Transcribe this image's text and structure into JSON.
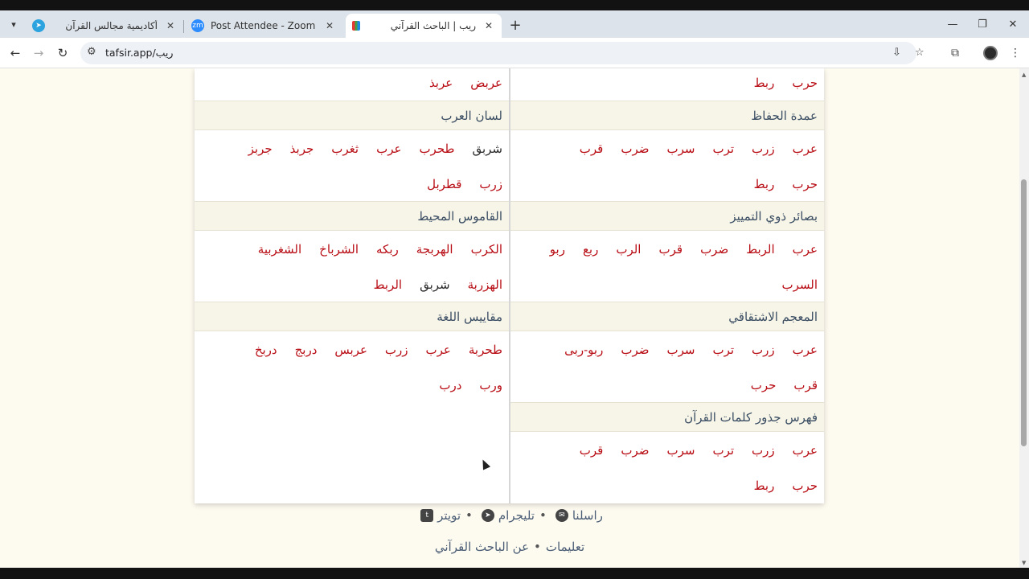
{
  "tabs": [
    {
      "title": "أكاديمية مجالس القرآن",
      "icon": "telegram-icon",
      "active": false
    },
    {
      "title": "Post Attendee - Zoom",
      "icon": "zoom-icon",
      "active": false
    },
    {
      "title": "ريب | الباحث القرآني",
      "icon": "tafsir-icon",
      "active": true
    }
  ],
  "address": {
    "url": "tafsir.app/ريب"
  },
  "right_column": {
    "top_row": [
      "حرب",
      "ربط"
    ],
    "sections": [
      {
        "title": "عمدة الحفاظ",
        "rows": [
          [
            "عرب",
            "زرب",
            "ترب",
            "سرب",
            "ضرب",
            "قرب"
          ],
          [
            "حرب",
            "ربط"
          ]
        ]
      },
      {
        "title": "بصائر ذوي التمييز",
        "rows": [
          [
            "عرب",
            "الربط",
            "ضرب",
            "قرب",
            "الرب",
            "ربع",
            "ربو"
          ],
          [
            "السرب"
          ]
        ]
      },
      {
        "title": "المعجم الاشتقاقي",
        "rows": [
          [
            "عرب",
            "زرب",
            "ترب",
            "سرب",
            "ضرب",
            "ربو-ربى"
          ],
          [
            "قرب",
            "حرب"
          ]
        ]
      },
      {
        "title": "فهرس جذور كلمات القرآن",
        "rows": [
          [
            "عرب",
            "زرب",
            "ترب",
            "سرب",
            "ضرب",
            "قرب"
          ],
          [
            "حرب",
            "ربط"
          ]
        ]
      }
    ]
  },
  "left_column": {
    "top_row": [
      "عربض",
      "عربذ"
    ],
    "sections": [
      {
        "title": "لسان العرب",
        "rows": [
          [
            "شربق",
            "طحرب",
            "عرب",
            "ثغرب",
            "جربذ",
            "جربز"
          ],
          [
            "زرب",
            "قطربل"
          ]
        ]
      },
      {
        "title": "القاموس المحيط",
        "rows": [
          [
            "الكرب",
            "الهربجة",
            "ربكه",
            "الشرباخ",
            "الشغربية"
          ],
          [
            "الهزربة",
            "شربق",
            "الربط"
          ]
        ]
      },
      {
        "title": "مقاييس اللغة",
        "rows": [
          [
            "طحربة",
            "عرب",
            "زرب",
            "عربس",
            "دربج",
            "دربخ"
          ],
          [
            "ورب",
            "درب"
          ]
        ]
      }
    ]
  },
  "footer": {
    "contact": "راسلنا",
    "telegram": "تليجرام",
    "twitter": "تويتر",
    "instructions": "تعليمات",
    "about": "عن الباحث القرآني",
    "separator": "•"
  },
  "colors": {
    "accent_word": "#b80d15",
    "section_bg": "#f7f5e8",
    "page_bg": "#fdfaf0"
  }
}
